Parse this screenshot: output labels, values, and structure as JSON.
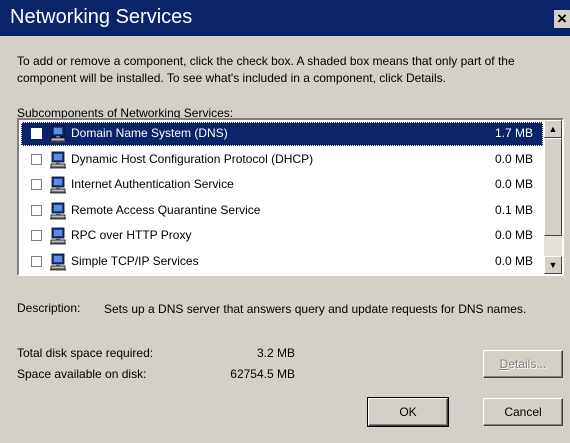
{
  "window": {
    "title": "Networking Services",
    "close_glyph": "×"
  },
  "instructions": "To add or remove a component, click the check box. A shaded box means that only part of the component will be installed. To see what's included in a component, click Details.",
  "subcomponents": {
    "label_prefix": "Sub",
    "label_accel": "c",
    "label_suffix": "omponents of Networking Services:",
    "items": [
      {
        "name": "Domain Name System (DNS)",
        "size": "1.7 MB",
        "checked": false,
        "selected": true
      },
      {
        "name": "Dynamic Host Configuration Protocol (DHCP)",
        "size": "0.0 MB",
        "checked": false,
        "selected": false
      },
      {
        "name": "Internet Authentication Service",
        "size": "0.0 MB",
        "checked": false,
        "selected": false
      },
      {
        "name": "Remote Access Quarantine Service",
        "size": "0.1 MB",
        "checked": false,
        "selected": false
      },
      {
        "name": "RPC over HTTP Proxy",
        "size": "0.0 MB",
        "checked": false,
        "selected": false
      },
      {
        "name": "Simple TCP/IP Services",
        "size": "0.0 MB",
        "checked": false,
        "selected": false
      }
    ],
    "icon": "network-computer-icon"
  },
  "description": {
    "label": "Description:",
    "text": "Sets up a DNS server that answers query and update requests for DNS names."
  },
  "disk": {
    "required_label": "Total disk space required:",
    "required_value": "3.2 MB",
    "available_label": "Space available on disk:",
    "available_value": "62754.5 MB"
  },
  "buttons": {
    "details_prefix": "",
    "details_accel": "D",
    "details_suffix": "etails...",
    "ok": "OK",
    "cancel": "Cancel"
  },
  "colors": {
    "titlebar": "#0a246a",
    "face": "#d4d0c8",
    "selection": "#0a246a"
  }
}
